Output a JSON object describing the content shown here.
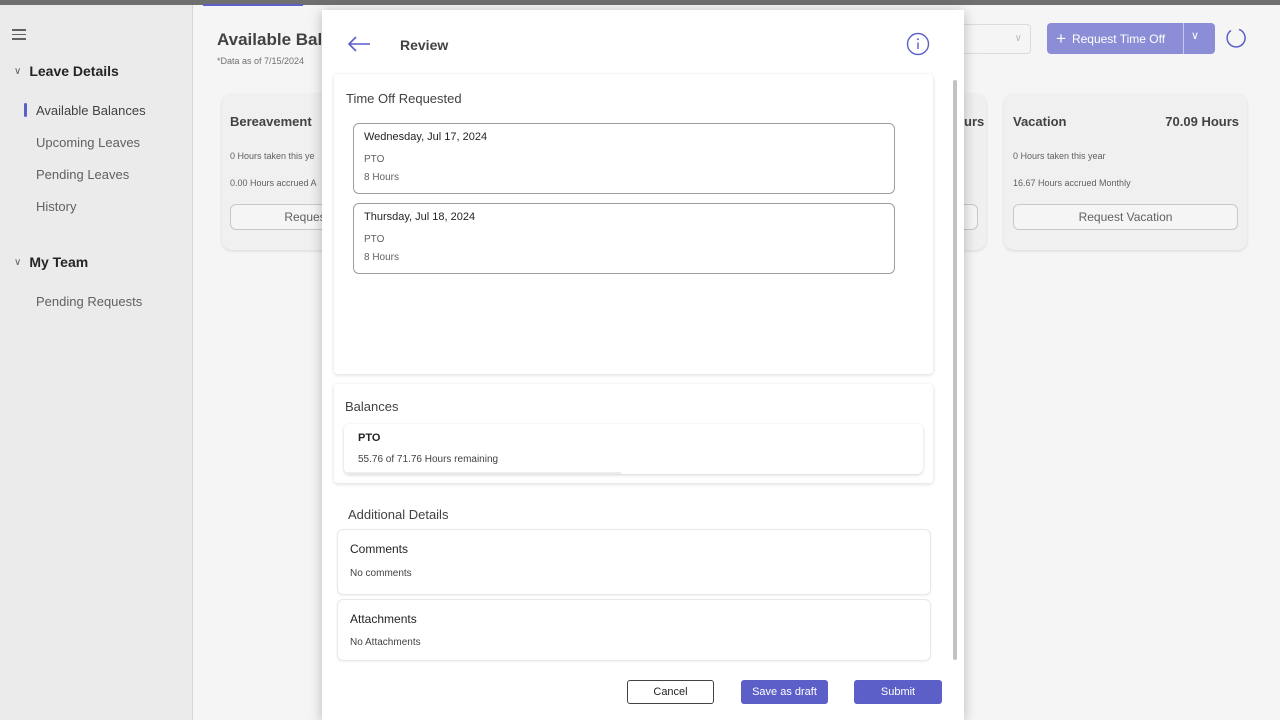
{
  "sidebar": {
    "groups": [
      {
        "label": "Leave Details",
        "items": [
          "Available Balances",
          "Upcoming Leaves",
          "Pending Leaves",
          "History"
        ]
      },
      {
        "label": "My Team",
        "items": [
          "Pending Requests"
        ]
      }
    ]
  },
  "main": {
    "title": "Available Bala",
    "subtitle": "*Data as of 7/15/2024",
    "request_button": "Request Time Off",
    "cards": [
      {
        "title": "Bereavement",
        "line1": "0 Hours taken this ye",
        "line2": "0.00 Hours accrued A",
        "button": "Reques"
      },
      {
        "title_fragment": "urs"
      },
      {
        "title": "Vacation",
        "hours": "70.09 Hours",
        "line1": "0 Hours taken this year",
        "line2": "16.67 Hours accrued Monthly",
        "button": "Request Vacation"
      }
    ]
  },
  "modal": {
    "title": "Review",
    "time_off": {
      "title": "Time Off Requested",
      "days": [
        {
          "date": "Wednesday, Jul 17, 2024",
          "type": "PTO",
          "hours": "8 Hours"
        },
        {
          "date": "Thursday, Jul 18, 2024",
          "type": "PTO",
          "hours": "8 Hours"
        }
      ]
    },
    "balances": {
      "title": "Balances",
      "name": "PTO",
      "remaining": "55.76 of 71.76 Hours remaining"
    },
    "additional": {
      "title": "Additional Details",
      "comments_label": "Comments",
      "comments_value": "No comments",
      "attachments_label": "Attachments",
      "attachments_value": "No Attachments"
    },
    "buttons": {
      "cancel": "Cancel",
      "draft": "Save as draft",
      "submit": "Submit"
    }
  },
  "colors": {
    "accent": "#5b5fc7",
    "accent_disabled": "#8b8ed6"
  }
}
